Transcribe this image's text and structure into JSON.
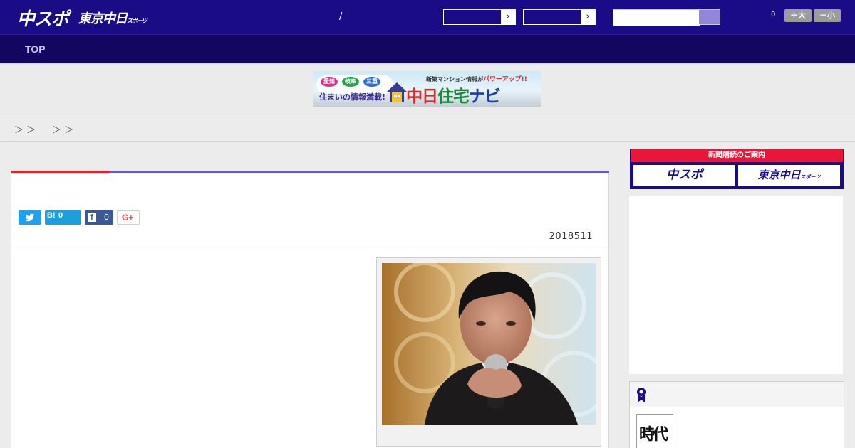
{
  "header": {
    "logo_chuspo": "中スポ",
    "logo_tokyo": "東京中日",
    "logo_tokyo_small": "スポーツ",
    "slash": "/",
    "select1_arrow": "›",
    "select2_arrow": "›",
    "search_placeholder": "",
    "count": "0",
    "font_larger": "＋大",
    "font_smaller": "－小"
  },
  "nav": {
    "top_label": "TOP"
  },
  "ad_banner": {
    "bubble1": "愛知",
    "bubble2": "岐阜",
    "bubble3": "三重",
    "left_text": "住まいの情報満載!",
    "top_text_a": "新築マンション情報が",
    "top_text_b": "パワーアップ!!",
    "main_a": "中日",
    "main_b": "住宅",
    "main_c": "ナビ"
  },
  "breadcrumb": {
    "sep1": "＞ ＞",
    "sep2": "＞ ＞"
  },
  "article": {
    "share": {
      "hatena_icon": "B!",
      "hatena_count": "0",
      "facebook_icon": "f",
      "facebook_count": "0",
      "gplus_label": "G+"
    },
    "date": "2018511"
  },
  "sidebar": {
    "subscription": {
      "header": "新聞購読のご案内",
      "chuspo": "中スポ",
      "tokyo": "東京中日",
      "tokyo_small": "スポーツ"
    },
    "ranking": {
      "thumb_text": "時代"
    }
  },
  "colors": {
    "header_bg": "#1a0b86",
    "nav_bg": "#120660",
    "accent_red": "#e0242a",
    "accent_purple": "#6a5bb8",
    "subscription_red": "#e8173a"
  }
}
